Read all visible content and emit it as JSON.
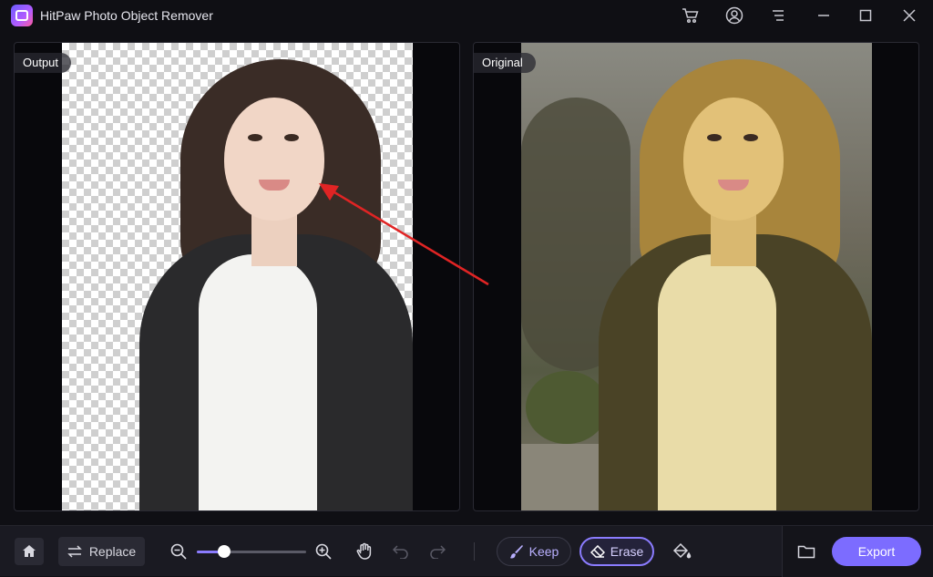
{
  "app": {
    "title": "HitPaw Photo Object Remover",
    "icons": [
      "cart-icon",
      "account-icon",
      "menu-icon",
      "minimize-icon",
      "maximize-icon",
      "close-icon"
    ]
  },
  "panels": {
    "output_label": "Output",
    "original_label": "Original"
  },
  "toolbar": {
    "replace_label": "Replace",
    "keep_label": "Keep",
    "erase_label": "Erase",
    "export_label": "Export",
    "zoom_level": 0.25
  },
  "colors": {
    "accent": "#8b7cff",
    "annotation_arrow": "#e02424"
  }
}
